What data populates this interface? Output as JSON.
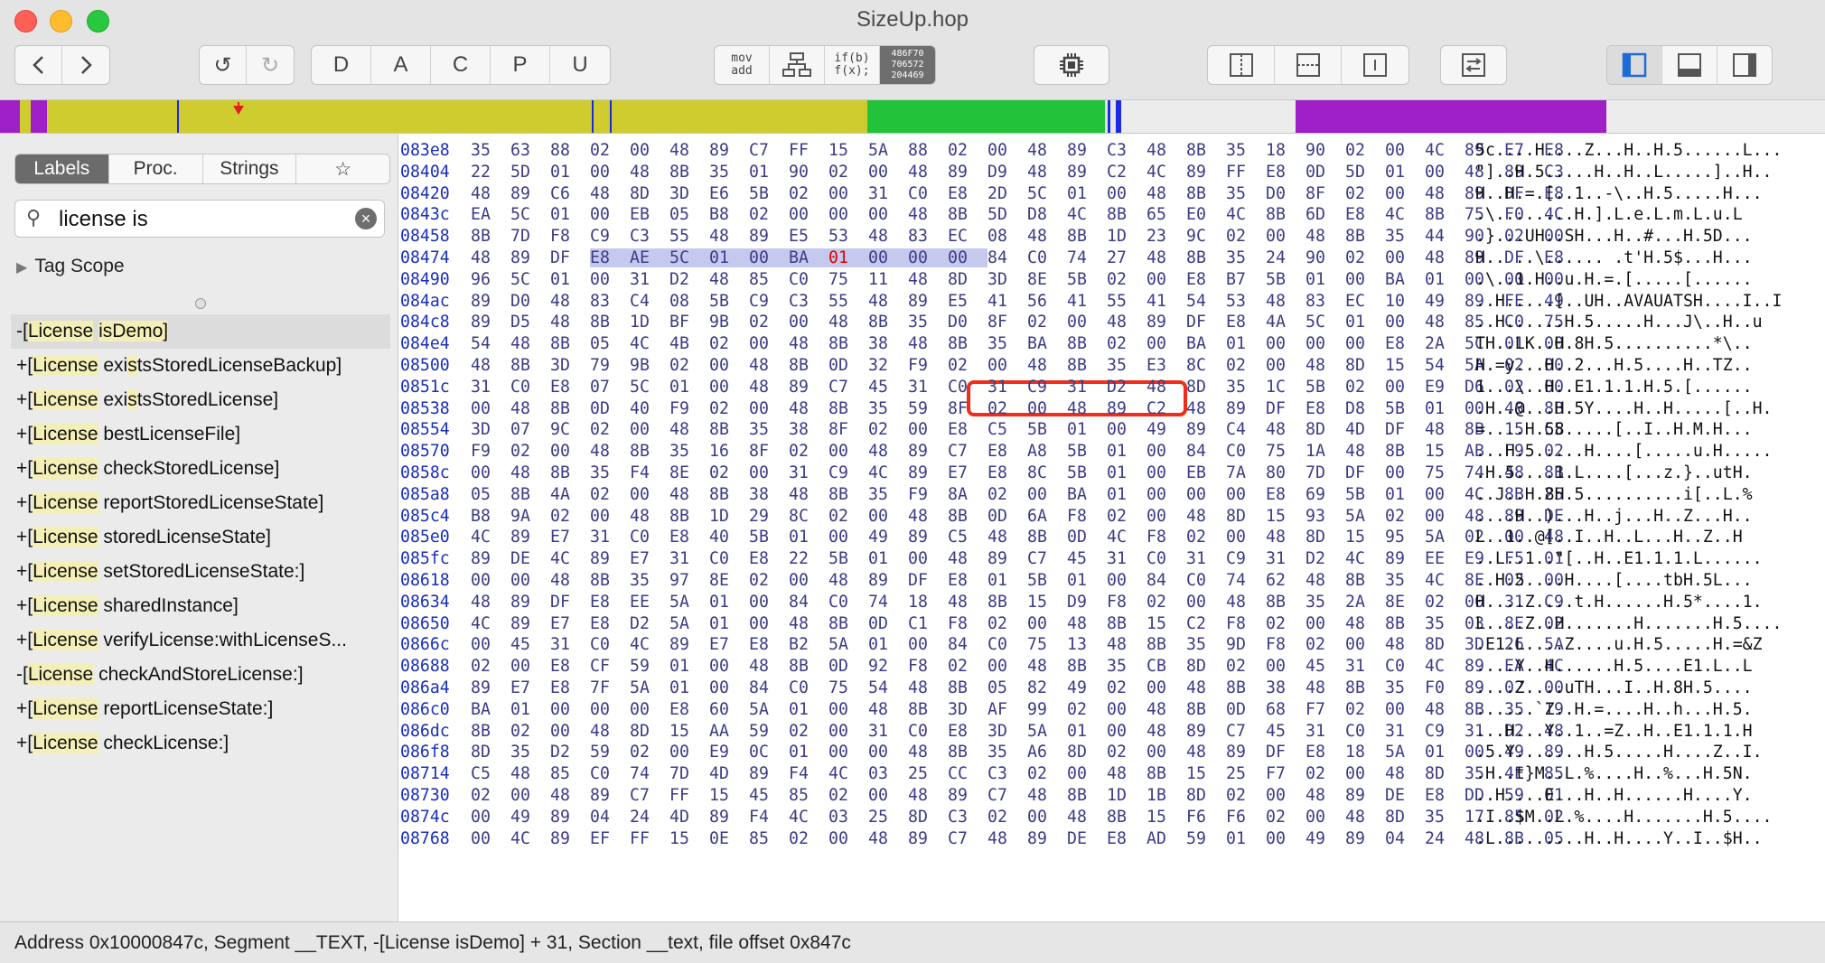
{
  "window": {
    "title": "SizeUp.hop"
  },
  "toolbar": {
    "nav": [
      "<",
      ">"
    ],
    "history": [
      "↺",
      "↻"
    ],
    "modes": [
      "D",
      "A",
      "C",
      "P",
      "U"
    ],
    "view_mov": "mov\nadd",
    "view_ifb": "if(b)\nf(x);",
    "view_hex": "486F70\n706572\n204469"
  },
  "segments": {
    "colors": {
      "gray": "#e6e6e6",
      "purple": "#a020c8",
      "olive": "#cfcc30",
      "green": "#22c33a",
      "blue": "#1a2ae0",
      "marker": "#e02020"
    }
  },
  "sidebar": {
    "tabs": [
      "Labels",
      "Proc.",
      "Strings",
      "☆"
    ],
    "search": {
      "value": "license is",
      "placeholder": ""
    },
    "tag_scope": "Tag Scope",
    "labels": [
      {
        "p": "-[",
        "cls": "License",
        "sp": " ",
        "sel": "isDemo]",
        "kind": "demo"
      },
      {
        "p": "+[",
        "cls": "License",
        "sp": " ",
        "a": "exi",
        "b": "s",
        "c": "ts",
        "d": "S",
        "e": "toredLicenseBackup]",
        "kind": "gen"
      },
      {
        "p": "+[",
        "cls": "License",
        "sp": " ",
        "a": "exi",
        "b": "s",
        "c": "ts",
        "d": "S",
        "e": "toredLicense]",
        "kind": "gen"
      },
      {
        "p": "+[",
        "cls": "License",
        "sp": " ",
        "e": "bestLicenseFile]",
        "kind": "gen"
      },
      {
        "p": "+[",
        "cls": "License",
        "sp": " ",
        "e": "checkStoredLicense]",
        "kind": "gen"
      },
      {
        "p": "+[",
        "cls": "License",
        "sp": " ",
        "e": "reportStoredLicenseState]",
        "kind": "gen"
      },
      {
        "p": "+[",
        "cls": "License",
        "sp": " ",
        "e": "storedLicenseState]",
        "kind": "gen"
      },
      {
        "p": "+[",
        "cls": "License",
        "sp": " ",
        "e": "setStoredLicenseState:]",
        "kind": "gen"
      },
      {
        "p": "+[",
        "cls": "License",
        "sp": " ",
        "e": "sharedInstance]",
        "kind": "gen"
      },
      {
        "p": "+[",
        "cls": "License",
        "sp": " ",
        "e": "verifyLicense:withLicenseS...",
        "kind": "gen"
      },
      {
        "p": "-[",
        "cls": "License",
        "sp": " ",
        "e": "checkAndStoreLicense:]",
        "kind": "gen"
      },
      {
        "p": "+[",
        "cls": "License",
        "sp": " ",
        "e": "reportLicenseState:]",
        "kind": "gen"
      },
      {
        "p": "+[",
        "cls": "License",
        "sp": " ",
        "e": "checkLicense:]",
        "kind": "gen"
      }
    ]
  },
  "hex": {
    "rows": [
      {
        "addr": "083e8",
        "bytes": "35 63 88 02 00 48 89 C7 FF 15 5A 88 02 00 48 89 C3 48 8B 35 18 90 02 00 4C 89 E7 E8",
        "ascii": "5c....H....Z...H..H.5......L..."
      },
      {
        "addr": "08404",
        "bytes": "22 5D 01 00 48 8B 35 01 90 02 00 48 89 D9 48 89 C2 4C 89 FF E8 0D 5D 01 00 48 89 C3",
        "ascii": "\"]..H.5.....H..H..L.....]..H.."
      },
      {
        "addr": "08420",
        "bytes": "48 89 C6 48 8D 3D E6 5B 02 00 31 C0 E8 2D 5C 01 00 48 8B 35 D0 8F 02 00 48 89 DF E8",
        "ascii": "H..H.=.[..1..-\\..H.5.....H..."
      },
      {
        "addr": "0843c",
        "bytes": "EA 5C 01 00 EB 05 B8 02 00 00 00 48 8B 5D D8 4C 8B 65 E0 4C 8B 6D E8 4C 8B 75 F0 4C",
        "ascii": ".\\........H.].L.e.L.m.L.u.L"
      },
      {
        "addr": "08458",
        "bytes": "8B 7D F8 C9 C3 55 48 89 E5 53 48 83 EC 08 48 8B 1D 23 9C 02 00 48 8B 35 44 90 02 00",
        "ascii": ".}...UH..SH...H..#...H.5D..."
      },
      {
        "addr": "08474",
        "bytes": "48 89 DF E8 AE 5C 01 00 BA 01 00 00 00 84 C0 74 27 48 8B 35 24 90 02 00 48 89 DF E8",
        "ascii": "H.. ..\\...... .t'H.5$...H...",
        "special": true
      },
      {
        "addr": "08490",
        "bytes": "96 5C 01 00 31 D2 48 85 C0 75 11 48 8D 3D 8E 5B 02 00 E8 B7 5B 01 00 BA 01 00 00 00",
        "ascii": ".\\..1.H..u.H.=.[.....[......"
      },
      {
        "addr": "084ac",
        "bytes": "89 D0 48 83 C4 08 5B C9 C3 55 48 89 E5 41 56 41 55 41 54 53 48 83 EC 10 49 89 FE 49",
        "ascii": "..H.....[..UH..AVAUATSH....I..I"
      },
      {
        "addr": "084c8",
        "bytes": "89 D5 48 8B 1D BF 9B 02 00 48 8B 35 D0 8F 02 00 48 89 DF E8 4A 5C 01 00 48 85 C0 75",
        "ascii": "..H......H.5.....H...J\\..H..u"
      },
      {
        "addr": "084e4",
        "bytes": "54 48 8B 05 4C 4B 02 00 48 8B 38 48 8B 35 BA 8B 02 00 BA 01 00 00 00 E8 2A 5C 01 00",
        "ascii": "TH..LK..H.8H.5..........*\\.."
      },
      {
        "addr": "08500",
        "bytes": "48 8B 3D 79 9B 02 00 48 8B 0D 32 F9 02 00 48 8B 35 E3 8C 02 00 48 8D 15 54 5A 02 00",
        "ascii": "H.=y...H..2...H.5....H..TZ.."
      },
      {
        "addr": "0851c",
        "bytes": "31 C0 E8 07 5C 01 00 48 89 C7 45 31 C0 31 C9 31 D2 48 8D 35 1C 5B 02 00 E9 D6 02 00",
        "ascii": "1...\\..H..E1.1.1.H.5.[......"
      },
      {
        "addr": "08538",
        "bytes": "00 48 8B 0D 40 F9 02 00 48 8B 35 59 8F 02 00 48 89 C2 48 89 DF E8 D8 5B 01 00 48 8B",
        "ascii": ".H..@...H.5Y....H..H.....[..H."
      },
      {
        "addr": "08554",
        "bytes": "3D 07 9C 02 00 48 8B 35 38 8F 02 00 E8 C5 5B 01 00 49 89 C4 48 8D 4D DF 48 8B 15 C5",
        "ascii": "=....H.58.....[..I..H.M.H..."
      },
      {
        "addr": "08570",
        "bytes": "F9 02 00 48 8B 35 16 8F 02 00 48 89 C7 E8 A8 5B 01 00 84 C0 75 1A 48 8B 15 AB F9 02",
        "ascii": "...H.5.....H....[.....u.H....."
      },
      {
        "addr": "0858c",
        "bytes": "00 48 8B 35 F4 8E 02 00 31 C9 4C 89 E7 E8 8C 5B 01 00 EB 7A 80 7D DF 00 75 74 48 8B",
        "ascii": ".H.5....1.L....[...z.}..utH."
      },
      {
        "addr": "085a8",
        "bytes": "05 8B 4A 02 00 48 8B 38 48 8B 35 F9 8A 02 00 BA 01 00 00 00 E8 69 5B 01 00 4C 8B 25",
        "ascii": "..J..H.8H.5..........i[..L.%"
      },
      {
        "addr": "085c4",
        "bytes": "B8 9A 02 00 48 8B 1D 29 8C 02 00 48 8B 0D 6A F8 02 00 48 8D 15 93 5A 02 00 48 89 DE",
        "ascii": "....H..)...H..j...H..Z...H.."
      },
      {
        "addr": "085e0",
        "bytes": "4C 89 E7 31 C0 E8 40 5B 01 00 49 89 C5 48 8B 0D 4C F8 02 00 48 8D 15 95 5A 02 00 48",
        "ascii": "L..1..@[..I..H..L...H..Z..H"
      },
      {
        "addr": "085fc",
        "bytes": "89 DE 4C 89 E7 31 C0 E8 22 5B 01 00 48 89 C7 45 31 C0 31 C9 31 D2 4C 89 EE E9 F5 01",
        "ascii": "..L..1..\"[..H..E1.1.1.L......"
      },
      {
        "addr": "08618",
        "bytes": "00 00 48 8B 35 97 8E 02 00 48 89 DF E8 01 5B 01 00 84 C0 74 62 48 8B 35 4C 8E 02 00",
        "ascii": "..H.5....H....[....tbH.5L..."
      },
      {
        "addr": "08634",
        "bytes": "48 89 DF E8 EE 5A 01 00 84 C0 74 18 48 8B 15 D9 F8 02 00 48 8B 35 2A 8E 02 00 31 C9",
        "ascii": "H....Z....t.H......H.5*....1."
      },
      {
        "addr": "08650",
        "bytes": "4C 89 E7 E8 D2 5A 01 00 48 8B 0D C1 F8 02 00 48 8B 15 C2 F8 02 00 48 8B 35 03 8E 02",
        "ascii": "L....Z..H.......H.......H.5...."
      },
      {
        "addr": "0866c",
        "bytes": "00 45 31 C0 4C 89 E7 E8 B2 5A 01 00 84 C0 75 13 48 8B 35 9D F8 02 00 48 8D 3D 26 5A",
        "ascii": ".E1.L....Z....u.H.5.....H.=&Z"
      },
      {
        "addr": "08688",
        "bytes": "02 00 E8 CF 59 01 00 48 8B 0D 92 F8 02 00 48 8B 35 CB 8D 02 00 45 31 C0 4C 89 EA 4C",
        "ascii": "....Y..H......H.5....E1.L..L"
      },
      {
        "addr": "086a4",
        "bytes": "89 E7 E8 7F 5A 01 00 84 C0 75 54 48 8B 05 82 49 02 00 48 8B 38 48 8B 35 F0 89 02 00",
        "ascii": "....Z....uTH...I..H.8H.5...."
      },
      {
        "addr": "086c0",
        "bytes": "BA 01 00 00 00 E8 60 5A 01 00 48 8B 3D AF 99 02 00 48 8B 0D 68 F7 02 00 48 8B 35 19",
        "ascii": "......`Z..H.=....H..h...H.5."
      },
      {
        "addr": "086dc",
        "bytes": "8B 02 00 48 8D 15 AA 59 02 00 31 C0 E8 3D 5A 01 00 48 89 C7 45 31 C0 31 C9 31 D2 48",
        "ascii": "...H...Y..1..=Z..H..E1.1.1.H"
      },
      {
        "addr": "086f8",
        "bytes": "8D 35 D2 59 02 00 E9 0C 01 00 00 48 8B 35 A6 8D 02 00 48 89 DF E8 18 5A 01 00 49 89",
        "ascii": ".5.Y.......H.5.....H....Z..I."
      },
      {
        "addr": "08714",
        "bytes": "C5 48 85 C0 74 7D 4D 89 F4 4C 03 25 CC C3 02 00 48 8B 15 25 F7 02 00 48 8D 35 4E 85",
        "ascii": ".H..t}M..L.%....H..%...H.5N."
      },
      {
        "addr": "08730",
        "bytes": "02 00 48 89 C7 FF 15 45 85 02 00 48 89 C7 48 8B 1D 1B 8D 02 00 48 89 DE E8 DD 59 01",
        "ascii": "..H....E...H..H......H....Y."
      },
      {
        "addr": "0874c",
        "bytes": "00 49 89 04 24 4D 89 F4 4C 03 25 8D C3 02 00 48 8B 15 F6 F6 02 00 48 8D 35 17 85 02",
        "ascii": ".I..$M..L.%....H.......H.5...."
      },
      {
        "addr": "08768",
        "bytes": "00 4C 89 EF FF 15 0E 85 02 00 48 89 C7 48 89 DE E8 AD 59 01 00 49 89 04 24 48 8B 05",
        "ascii": ".L.........H..H....Y..I..$H.."
      }
    ]
  },
  "status": {
    "text": "Address 0x10000847c, Segment __TEXT, -[License isDemo] + 31, Section __text, file offset 0x847c"
  }
}
